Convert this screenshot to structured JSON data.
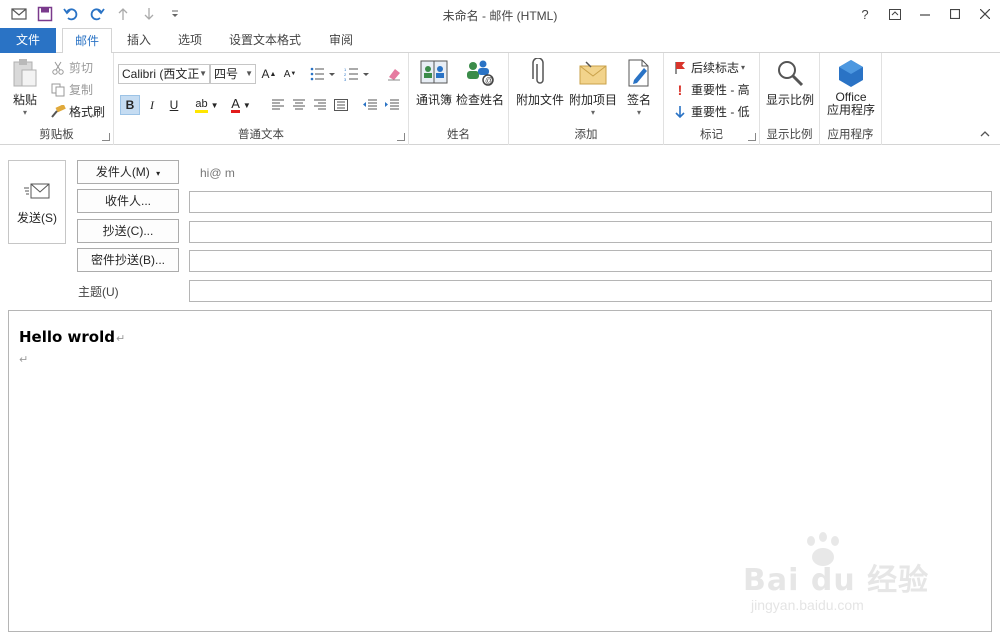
{
  "window": {
    "title": "未命名 - 邮件 (HTML)",
    "help": "?",
    "restore_ribbon": "⊡",
    "minimize": "—",
    "maximize": "☐",
    "close": "✕"
  },
  "tabs": {
    "file": "文件",
    "mail": "邮件",
    "insert": "插入",
    "options": "选项",
    "format_text": "设置文本格式",
    "review": "审阅"
  },
  "ribbon": {
    "clipboard": {
      "label": "剪贴板",
      "paste": "粘贴",
      "cut": "剪切",
      "copy": "复制",
      "format_painter": "格式刷"
    },
    "basic_text": {
      "label": "普通文本",
      "font": "Calibri (西文正",
      "size": "四号",
      "bold": "B",
      "italic": "I",
      "underline": "U",
      "grow": "A",
      "shrink": "A",
      "highlight": "ab",
      "font_color": "A"
    },
    "names": {
      "label": "姓名",
      "address_book": "通讯簿",
      "check_names": "检查姓名"
    },
    "include": {
      "label": "添加",
      "attach_file": "附加文件",
      "attach_item": "附加项目",
      "signature": "签名"
    },
    "tags": {
      "label": "标记",
      "follow_up": "后续标志",
      "high": "重要性 - 高",
      "low": "重要性 - 低"
    },
    "zoom": {
      "label": "显示比例",
      "button": "显示比例"
    },
    "apps": {
      "label": "应用程序",
      "office_line1": "Office",
      "office_line2": "应用程序"
    }
  },
  "header": {
    "send": "发送(S)",
    "from_button": "发件人(M)",
    "from_value": "          hi@              m",
    "to_button": "收件人...",
    "cc_button": "抄送(C)...",
    "bcc_button": "密件抄送(B)...",
    "subject_label": "主题(U)",
    "to_value": "",
    "cc_value": "",
    "bcc_value": "",
    "subject_value": ""
  },
  "body": {
    "line1": "Hello wrold",
    "pilcrow": "↵",
    "line2": "↵"
  },
  "watermark": {
    "text": "Bai du 经验",
    "url": "jingyan.baidu.com"
  }
}
